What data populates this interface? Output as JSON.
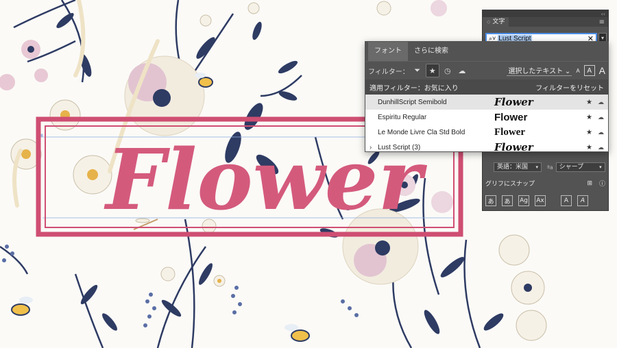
{
  "artwork": {
    "word": "Flower",
    "colors": {
      "word": "#d45a7c",
      "frame": "#cf4e72",
      "navy": "#2e3b63",
      "cream": "#f2ecdf",
      "pink": "#d8aec0"
    }
  },
  "panel": {
    "tab_label": "文字",
    "tab_close_icon": "close-icon",
    "menu_icon": "hamburger-icon",
    "search_value": "Lust Script",
    "lang_value": "英語：米国",
    "aa_symbol": "ªa",
    "aa_value": "シャープ",
    "snap_label": "グリフにスナップ",
    "snap_buttons": [
      "あ",
      "あ",
      "Ag",
      "Ax",
      "A",
      "A"
    ],
    "field_dropdown_arrow": "▾"
  },
  "dropdown": {
    "tabs": [
      "フォント",
      "さらに検索"
    ],
    "filter_label": "フィルター：",
    "filter_icons": [
      "filter-icon",
      "star-icon",
      "clock-icon",
      "cloud-icon"
    ],
    "select_label": "選択したテキスト",
    "size_labels": [
      "A",
      "A",
      "A"
    ],
    "applied_label": "適用フィルター：お気に入り",
    "reset_label": "フィルターをリセット",
    "fonts": [
      {
        "name": "DunhillScript Semibold",
        "preview": "Flower"
      },
      {
        "name": "Espiritu Regular",
        "preview": "Flower"
      },
      {
        "name": "Le Monde Livre Cla Std Bold",
        "preview": "Flower"
      },
      {
        "name": "Lust Script (3)",
        "preview": "Flower"
      }
    ]
  }
}
